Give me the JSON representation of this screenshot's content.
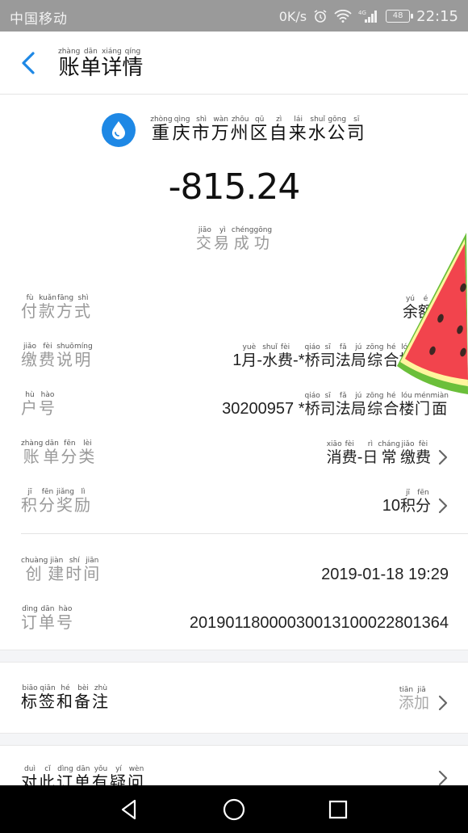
{
  "status_bar": {
    "carrier": "中国移动",
    "speed": "0K/s",
    "battery": "48",
    "time": "22:15"
  },
  "header": {
    "title": [
      {
        "c": "账",
        "p": "zhàng"
      },
      {
        "c": "单",
        "p": "dān"
      },
      {
        "c": "详",
        "p": "xiáng"
      },
      {
        "c": "情",
        "p": "qíng"
      }
    ]
  },
  "merchant": {
    "name": [
      {
        "c": "重",
        "p": "zhòng"
      },
      {
        "c": "庆",
        "p": "qìng"
      },
      {
        "c": "市",
        "p": "shì"
      },
      {
        "c": "万",
        "p": "wàn"
      },
      {
        "c": "州",
        "p": "zhōu"
      },
      {
        "c": "区",
        "p": "qū"
      },
      {
        "c": "自",
        "p": "zì"
      },
      {
        "c": "来",
        "p": "lái"
      },
      {
        "c": "水",
        "p": "shuǐ"
      },
      {
        "c": "公",
        "p": "gōng"
      },
      {
        "c": "司",
        "p": "sī"
      }
    ],
    "amount": "-815.24",
    "status": [
      {
        "c": "交",
        "p": "jiāo"
      },
      {
        "c": "易",
        "p": "yì"
      },
      {
        "c": "成",
        "p": "chéng"
      },
      {
        "c": "功",
        "p": "gōng"
      }
    ]
  },
  "details": [
    {
      "label": [
        {
          "c": "付",
          "p": "fù"
        },
        {
          "c": "款",
          "p": "kuǎn"
        },
        {
          "c": "方",
          "p": "fāng"
        },
        {
          "c": "式",
          "p": "shì"
        }
      ],
      "value": [
        {
          "c": "余",
          "p": "yú"
        },
        {
          "c": "额",
          "p": "é"
        },
        {
          "c": "宝",
          "p": "bǎo"
        }
      ],
      "has_arrow": false
    },
    {
      "label": [
        {
          "c": "缴",
          "p": "jiǎo"
        },
        {
          "c": "费",
          "p": "fèi"
        },
        {
          "c": "说",
          "p": "shuō"
        },
        {
          "c": "明",
          "p": "míng"
        }
      ],
      "value": [
        {
          "c": "1",
          "p": ""
        },
        {
          "c": "月",
          "p": "yuè"
        },
        {
          "c": "-",
          "p": ""
        },
        {
          "c": "水",
          "p": "shuǐ"
        },
        {
          "c": "费",
          "p": "fèi"
        },
        {
          "c": "-*",
          "p": ""
        },
        {
          "c": "桥",
          "p": "qiáo"
        },
        {
          "c": "司",
          "p": "sī"
        },
        {
          "c": "法",
          "p": "fǎ"
        },
        {
          "c": "局",
          "p": "jú"
        },
        {
          "c": "综",
          "p": "zōng"
        },
        {
          "c": "合",
          "p": "hé"
        },
        {
          "c": "楼",
          "p": "lóu"
        },
        {
          "c": "门",
          "p": "mén"
        },
        {
          "c": "面",
          "p": "miàn"
        }
      ],
      "has_arrow": false
    },
    {
      "label": [
        {
          "c": "户",
          "p": "hù"
        },
        {
          "c": "号",
          "p": "hào"
        }
      ],
      "value": [
        {
          "c": "30200957 *",
          "p": ""
        },
        {
          "c": "桥",
          "p": "qiáo"
        },
        {
          "c": "司",
          "p": "sī"
        },
        {
          "c": "法",
          "p": "fǎ"
        },
        {
          "c": "局",
          "p": "jú"
        },
        {
          "c": "综",
          "p": "zōng"
        },
        {
          "c": "合",
          "p": "hé"
        },
        {
          "c": "楼",
          "p": "lóu"
        },
        {
          "c": "门",
          "p": "mén"
        },
        {
          "c": "面",
          "p": "miàn"
        }
      ],
      "has_arrow": false
    },
    {
      "label": [
        {
          "c": "账",
          "p": "zhàng"
        },
        {
          "c": "单",
          "p": "dān"
        },
        {
          "c": "分",
          "p": "fēn"
        },
        {
          "c": "类",
          "p": "lèi"
        }
      ],
      "value": [
        {
          "c": "消",
          "p": "xiāo"
        },
        {
          "c": "费",
          "p": "fèi"
        },
        {
          "c": "-",
          "p": ""
        },
        {
          "c": "日",
          "p": "rì"
        },
        {
          "c": "常",
          "p": "cháng"
        },
        {
          "c": "缴",
          "p": "jiǎo"
        },
        {
          "c": "费",
          "p": "fèi"
        }
      ],
      "has_arrow": true
    },
    {
      "label": [
        {
          "c": "积",
          "p": "jī"
        },
        {
          "c": "分",
          "p": "fēn"
        },
        {
          "c": "奖",
          "p": "jiǎng"
        },
        {
          "c": "励",
          "p": "lì"
        }
      ],
      "value": [
        {
          "c": "10",
          "p": ""
        },
        {
          "c": "积",
          "p": "jī"
        },
        {
          "c": "分",
          "p": "fēn"
        }
      ],
      "has_arrow": true
    },
    {
      "label": [
        {
          "c": "创",
          "p": "chuàng"
        },
        {
          "c": "建",
          "p": "jiàn"
        },
        {
          "c": "时",
          "p": "shí"
        },
        {
          "c": "间",
          "p": "jiān"
        }
      ],
      "value": [
        {
          "c": "2019-01-18 19:29",
          "p": ""
        }
      ],
      "has_arrow": false
    },
    {
      "label": [
        {
          "c": "订",
          "p": "dìng"
        },
        {
          "c": "单",
          "p": "dān"
        },
        {
          "c": "号",
          "p": "hào"
        }
      ],
      "value": [
        {
          "c": "20190118000030013100022801364",
          "p": ""
        }
      ],
      "has_arrow": false
    }
  ],
  "notes": {
    "label": [
      {
        "c": "标",
        "p": "biāo"
      },
      {
        "c": "签",
        "p": "qiān"
      },
      {
        "c": "和",
        "p": "hé"
      },
      {
        "c": "备",
        "p": "bèi"
      },
      {
        "c": "注",
        "p": "zhù"
      }
    ],
    "action": [
      {
        "c": "添",
        "p": "tiān"
      },
      {
        "c": "加",
        "p": "jiā"
      }
    ]
  },
  "question": {
    "label": [
      {
        "c": "对",
        "p": "duì"
      },
      {
        "c": "此",
        "p": "cǐ"
      },
      {
        "c": "订",
        "p": "dìng"
      },
      {
        "c": "单",
        "p": "dān"
      },
      {
        "c": "有",
        "p": "yǒu"
      },
      {
        "c": "疑",
        "p": "yí"
      },
      {
        "c": "问",
        "p": "wèn"
      }
    ]
  },
  "colors": {
    "accent": "#1e88e5",
    "status_bar": "#9a9a9a",
    "label_gray": "#9a9a9a",
    "divider": "#e4e4e4"
  },
  "icons": {
    "back": "chevron-left-icon",
    "merchant_logo": "water-drop-icon",
    "row_arrow": "chevron-right-icon",
    "sticker": "watermelon-icon",
    "nav_back": "triangle-back-icon",
    "nav_home": "circle-home-icon",
    "nav_recent": "square-recent-icon"
  }
}
